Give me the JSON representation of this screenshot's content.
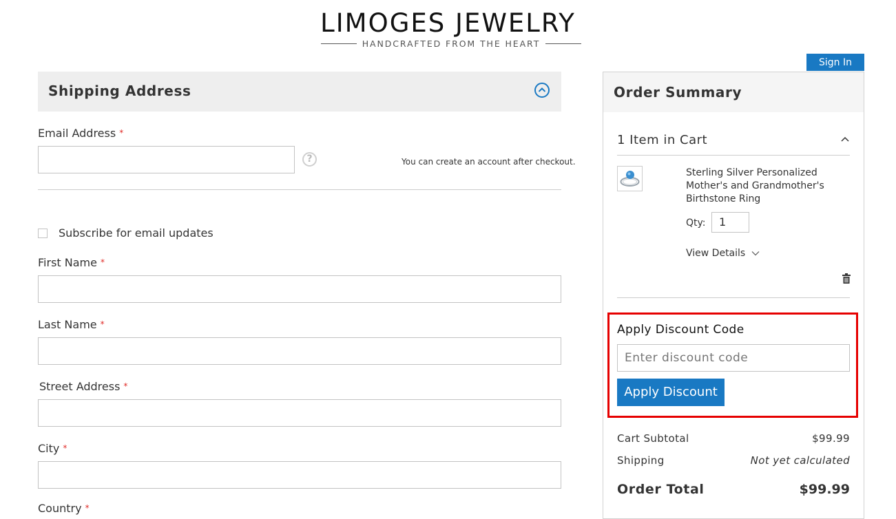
{
  "header": {
    "logo_title": "LIMOGES JEWELRY",
    "logo_tagline": "HANDCRAFTED FROM THE HEART",
    "sign_in_label": "Sign In"
  },
  "shipping": {
    "title": "Shipping Address",
    "email_label": "Email Address",
    "email_value": "",
    "email_hint": "You can create an account after checkout.",
    "subscribe_label": "Subscribe for email updates",
    "subscribe_checked": false,
    "first_name_label": "First Name",
    "last_name_label": "Last Name",
    "street_label": "Street Address",
    "city_label": "City",
    "country_label": "Country",
    "required_mark": "*"
  },
  "summary": {
    "title": "Order Summary",
    "items_count": "1 Item in Cart",
    "item": {
      "name": "Sterling Silver Personalized Mother's and Grandmother's Birthstone Ring",
      "qty_label": "Qty:",
      "qty_value": "1",
      "view_details": "View Details"
    },
    "discount": {
      "title": "Apply Discount Code",
      "placeholder": "Enter discount code",
      "button": "Apply Discount"
    },
    "totals": {
      "subtotal_label": "Cart Subtotal",
      "subtotal_value": "$99.99",
      "shipping_label": "Shipping",
      "shipping_value": "Not yet calculated",
      "total_label": "Order Total",
      "total_value": "$99.99"
    }
  },
  "colors": {
    "accent": "#1979c3",
    "required": "#e02b27",
    "highlight": "#e60000"
  }
}
